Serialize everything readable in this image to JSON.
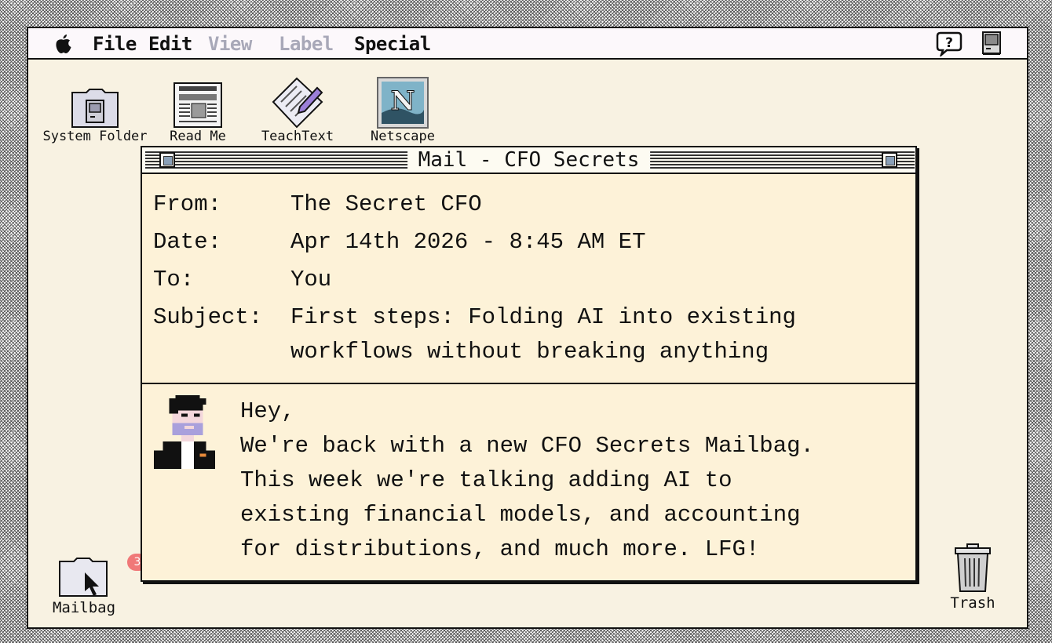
{
  "menubar": {
    "apple_icon": "apple-icon",
    "items": [
      {
        "label": "File",
        "enabled": true
      },
      {
        "label": "Edit",
        "enabled": true
      },
      {
        "label": "View",
        "enabled": false
      },
      {
        "label": "Label",
        "enabled": false
      },
      {
        "label": "Special",
        "enabled": true
      }
    ],
    "right_icons": [
      "help-balloon-icon",
      "mac-finder-icon"
    ]
  },
  "desktop": {
    "icons": [
      {
        "label": "System Folder",
        "icon": "system-folder-icon"
      },
      {
        "label": "Read Me",
        "icon": "newspaper-icon"
      },
      {
        "label": "TeachText",
        "icon": "teachtext-icon"
      },
      {
        "label": "Netscape",
        "icon": "netscape-icon"
      }
    ],
    "mailbag": {
      "label": "Mailbag",
      "badge": "3",
      "icon": "mailbag-folder-icon"
    },
    "trash": {
      "label": "Trash",
      "icon": "trash-icon"
    }
  },
  "window": {
    "title": "Mail - CFO Secrets",
    "header": {
      "from_label": "From:",
      "from_value": "The Secret CFO",
      "date_label": "Date:",
      "date_value": "Apr 14th 2026 - 8:45 AM ET",
      "to_label": "To:",
      "to_value": "You",
      "subject_label": "Subject:",
      "subject_line1": "First steps: Folding AI into existing",
      "subject_line2": "workflows without breaking anything"
    },
    "body": {
      "avatar": "cfo-avatar-icon",
      "lines": [
        "Hey,",
        "We're back with a new CFO Secrets Mailbag.",
        "This week we're talking adding AI to",
        "existing financial models, and accounting",
        "for distributions, and much more. LFG!"
      ]
    }
  },
  "colors": {
    "desktop_bg": "#f8f2e2",
    "window_bg": "#fdf2d8",
    "menubar_bg": "#fcf8fb",
    "disabled_menu": "#a8a8b8",
    "badge": "#f07878"
  }
}
